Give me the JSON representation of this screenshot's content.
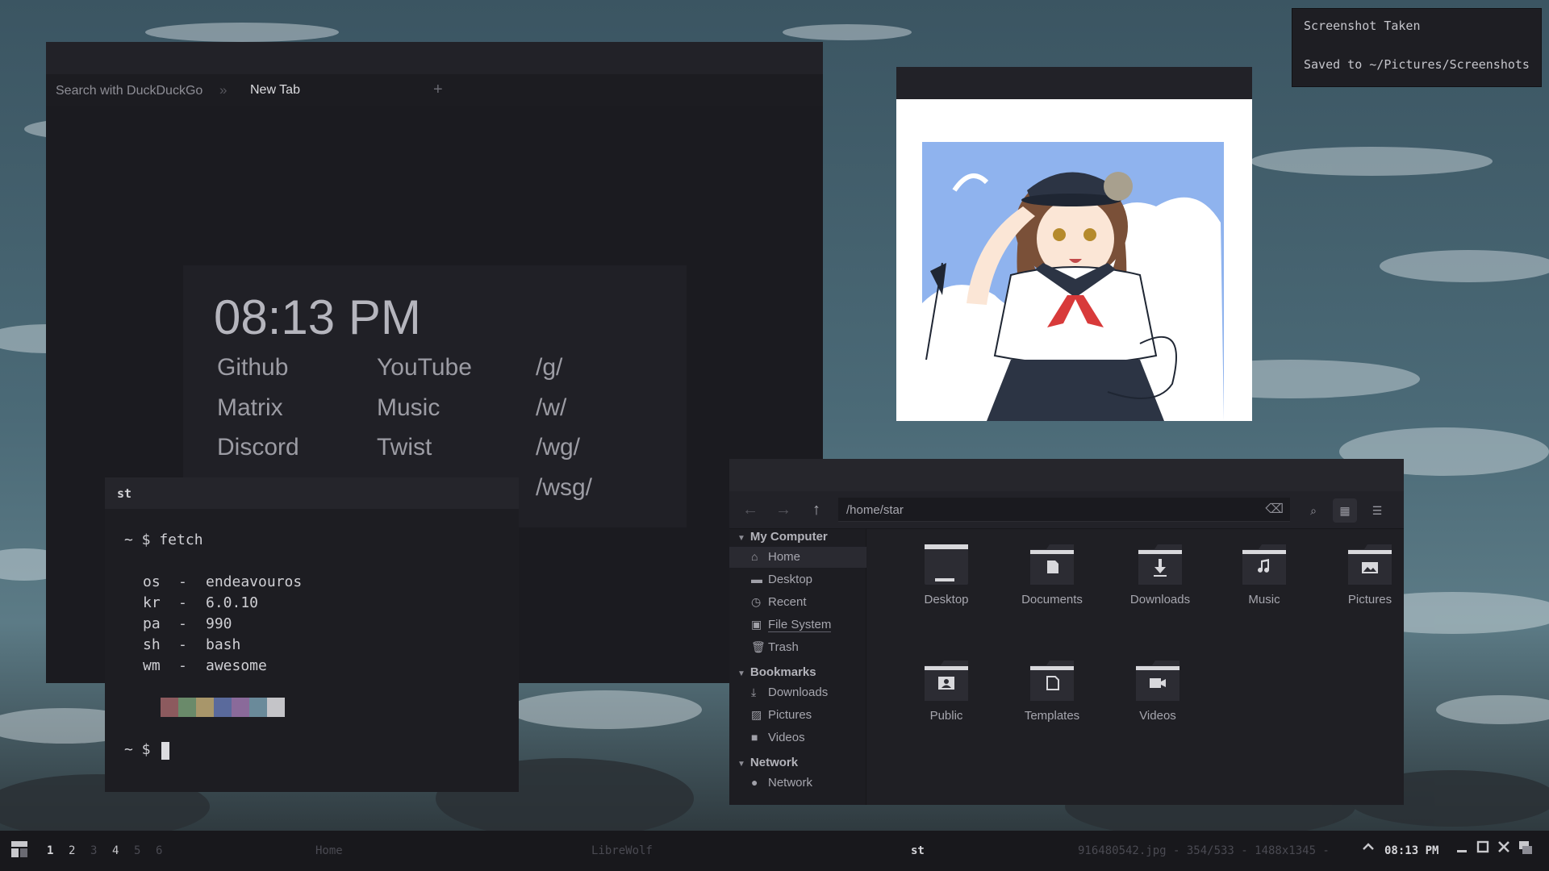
{
  "notification": {
    "title": "Screenshot Taken",
    "body": "Saved to ~/Pictures/Screenshots"
  },
  "browser": {
    "tab_search": "Search with DuckDuckGo",
    "tab_separator": "»",
    "tab_active": "New Tab",
    "new_tab_icon": "plus-icon",
    "startpage": {
      "clock": "08:13 PM",
      "links": [
        [
          "Github",
          "YouTube",
          "/g/"
        ],
        [
          "Matrix",
          "Music",
          "/w/"
        ],
        [
          "Discord",
          "Twist",
          "/wg/"
        ],
        [
          "",
          "",
          "/wsg/"
        ]
      ]
    }
  },
  "terminal": {
    "title": "st",
    "prompt1": "~ $ fetch",
    "info": [
      {
        "key": "os",
        "sep": "-",
        "value": "endeavouros"
      },
      {
        "key": "kr",
        "sep": "-",
        "value": "6.0.10"
      },
      {
        "key": "pa",
        "sep": "-",
        "value": "990"
      },
      {
        "key": "sh",
        "sep": "-",
        "value": "bash"
      },
      {
        "key": "wm",
        "sep": "-",
        "value": "awesome"
      }
    ],
    "palette": [
      "#1d1d22",
      "#8c5a5e",
      "#6a8a6a",
      "#a8966a",
      "#5a6a9c",
      "#8a6a9a",
      "#6a8a9a",
      "#c4c4c8"
    ],
    "prompt2": "~ $"
  },
  "file_manager": {
    "path": "/home/star",
    "sidebar": {
      "my_computer": "My Computer",
      "bookmarks": "Bookmarks",
      "network": "Network",
      "items": [
        {
          "label": "Home",
          "icon": "home-icon"
        },
        {
          "label": "Desktop",
          "icon": "desktop-icon"
        },
        {
          "label": "Recent",
          "icon": "clock-icon"
        },
        {
          "label": "File System",
          "icon": "drive-icon"
        },
        {
          "label": "Trash",
          "icon": "trash-icon"
        },
        {
          "label": "Downloads",
          "icon": "download-icon"
        },
        {
          "label": "Pictures",
          "icon": "image-icon"
        },
        {
          "label": "Videos",
          "icon": "video-icon"
        },
        {
          "label": "Network",
          "icon": "globe-icon"
        }
      ]
    },
    "folders": [
      {
        "label": "Desktop",
        "icon": "desktop-folder-icon"
      },
      {
        "label": "Documents",
        "icon": "documents-folder-icon"
      },
      {
        "label": "Downloads",
        "icon": "downloads-folder-icon"
      },
      {
        "label": "Music",
        "icon": "music-folder-icon"
      },
      {
        "label": "Pictures",
        "icon": "pictures-folder-icon"
      },
      {
        "label": "Public",
        "icon": "public-folder-icon"
      },
      {
        "label": "Templates",
        "icon": "templates-folder-icon"
      },
      {
        "label": "Videos",
        "icon": "videos-folder-icon"
      }
    ]
  },
  "taskbar": {
    "workspaces": [
      "1",
      "2",
      "3",
      "4",
      "5",
      "6"
    ],
    "active_workspace": "1",
    "occupied_workspaces": [
      "1",
      "2",
      "4"
    ],
    "tasks": [
      "Home",
      "LibreWolf",
      "st",
      "916480542.jpg - 354/533 - 1488x1345 -"
    ],
    "active_task": "st",
    "clock": "08:13 PM"
  },
  "colors": {
    "window_bg": "#1f1f24",
    "taskbar_bg": "#18181c",
    "notification_bg": "#1e1e23",
    "sky": "#8fb3ee"
  }
}
